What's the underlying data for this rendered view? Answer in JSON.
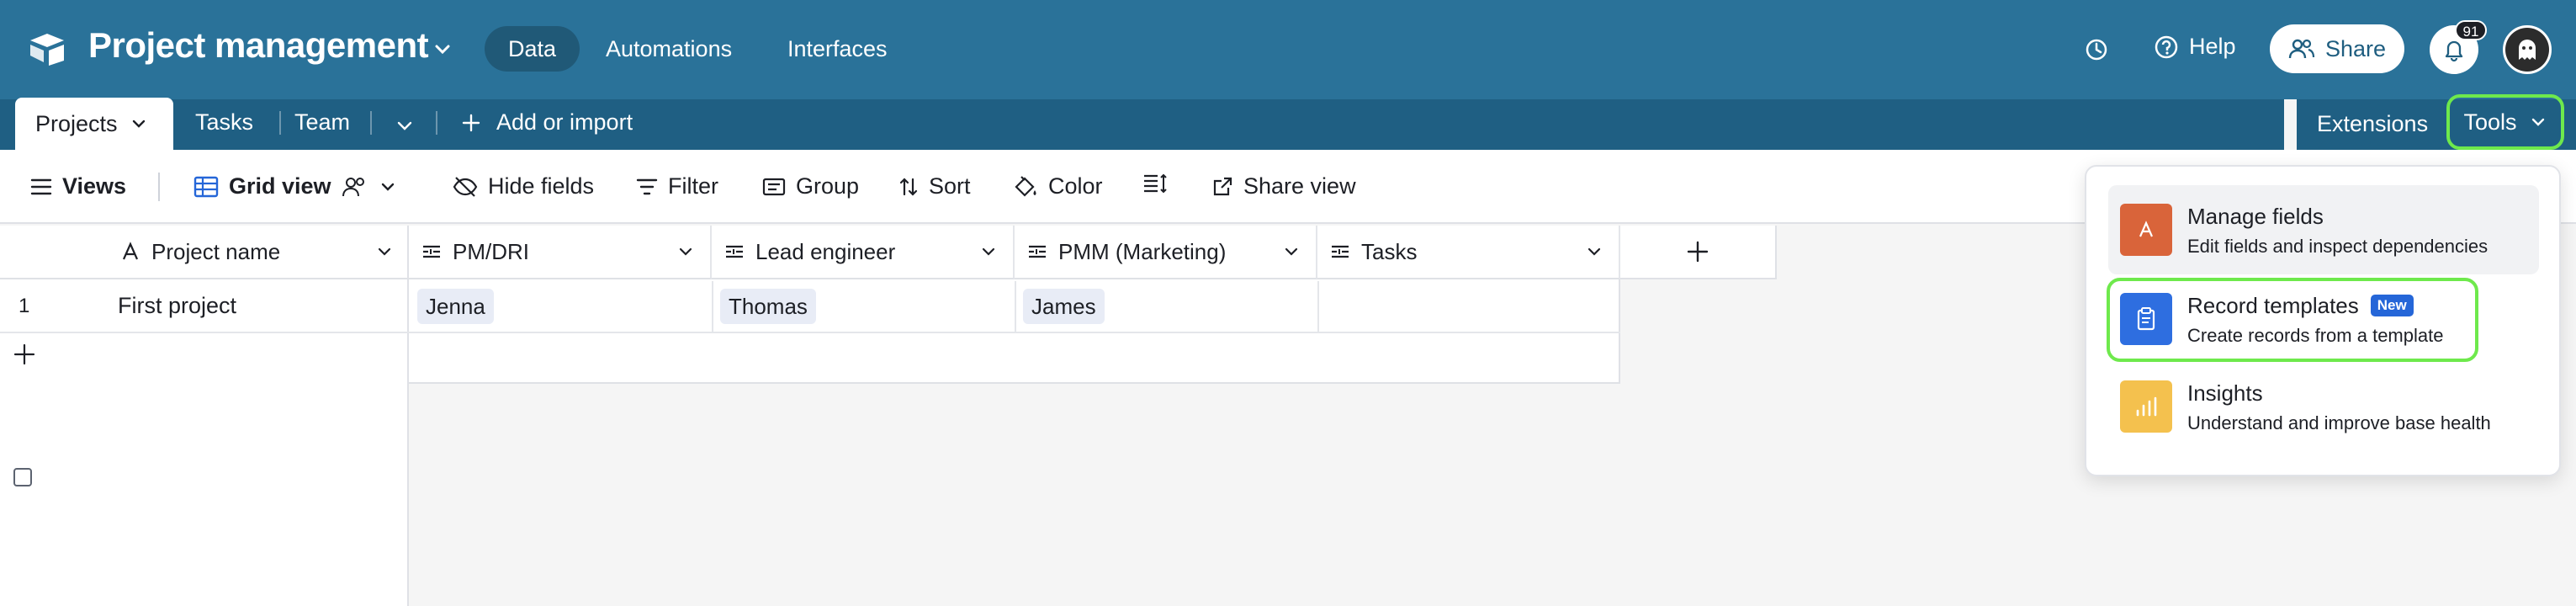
{
  "appbar": {
    "title": "Project management",
    "nav": [
      "Data",
      "Automations",
      "Interfaces"
    ],
    "help": "Help",
    "share": "Share",
    "notifications_count": "91",
    "colors": {
      "bar": "#2a7299",
      "tabbar": "#1f5f83",
      "highlight": "#6ee94c"
    }
  },
  "tabs": {
    "items": [
      "Projects",
      "Tasks",
      "Team"
    ],
    "add_import": "Add or import",
    "extensions": "Extensions",
    "tools": "Tools"
  },
  "viewbar": {
    "views": "Views",
    "grid_view": "Grid view",
    "hide_fields": "Hide fields",
    "filter": "Filter",
    "group": "Group",
    "sort": "Sort",
    "color": "Color",
    "share_view": "Share view"
  },
  "grid": {
    "columns": [
      "Project name",
      "PM/DRI",
      "Lead engineer",
      "PMM (Marketing)",
      "Tasks"
    ],
    "rows": [
      {
        "number": "1",
        "project_name": "First project",
        "pm_dri": "Jenna",
        "lead_engineer": "Thomas",
        "pmm": "James",
        "tasks": ""
      }
    ]
  },
  "tools_menu": {
    "items": [
      {
        "title": "Manage fields",
        "desc": "Edit fields and inspect dependencies",
        "icon": "text-field-icon",
        "color": "#d9643a"
      },
      {
        "title": "Record templates",
        "desc": "Create records from a template",
        "badge": "New",
        "icon": "clipboard-icon",
        "color": "#2e6ee0"
      },
      {
        "title": "Insights",
        "desc": "Understand and improve base health",
        "icon": "bar-chart-icon",
        "color": "#f4c14e"
      }
    ]
  }
}
